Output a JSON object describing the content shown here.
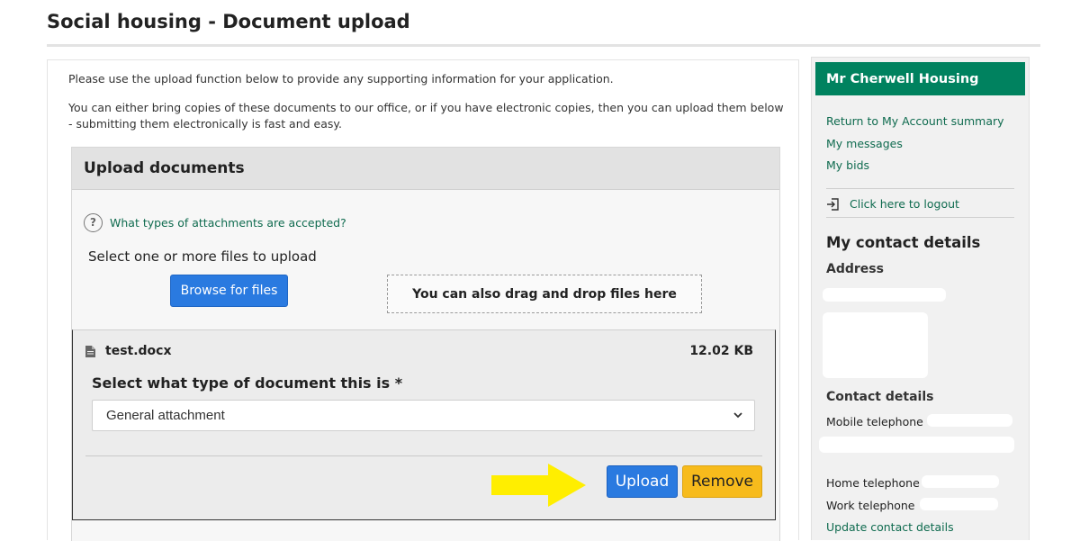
{
  "page": {
    "title": "Social housing - Document upload"
  },
  "intro": {
    "line1": "Please use the upload function below to provide any supporting information for your application.",
    "line2": "You can either bring copies of these documents to our office, or if you have electronic copies, then you can upload them below - submitting them electronically is fast and easy."
  },
  "upload": {
    "header": "Upload documents",
    "help_icon": "question-circle-icon",
    "help_link": "What types of attachments are accepted?",
    "select_label": "Select one or more files to upload",
    "browse_label": "Browse for files",
    "drop_zone_label": "You can also drag and drop files here",
    "file": {
      "icon": "file-icon",
      "name": "test.docx",
      "size": "12.02 KB",
      "doctype_label": "Select what type of document this is *",
      "doctype_selected": "General attachment",
      "upload_label": "Upload",
      "remove_label": "Remove"
    }
  },
  "sidebar": {
    "header": "Mr Cherwell Housing",
    "links": [
      "Return to My Account summary",
      "My messages",
      "My bids"
    ],
    "logout": "Click here to logout",
    "contact_title": "My contact details",
    "address_label": "Address",
    "contact_label": "Contact details",
    "mobile_label": "Mobile telephone",
    "home_label": "Home telephone",
    "work_label": "Work telephone",
    "update_link": "Update contact details"
  },
  "colors": {
    "accent_green": "#00825f",
    "link_green": "#0f6b4f",
    "primary_blue": "#2a7ae0",
    "remove_yellow": "#f7bb1c",
    "arrow_yellow": "#ffee00"
  }
}
